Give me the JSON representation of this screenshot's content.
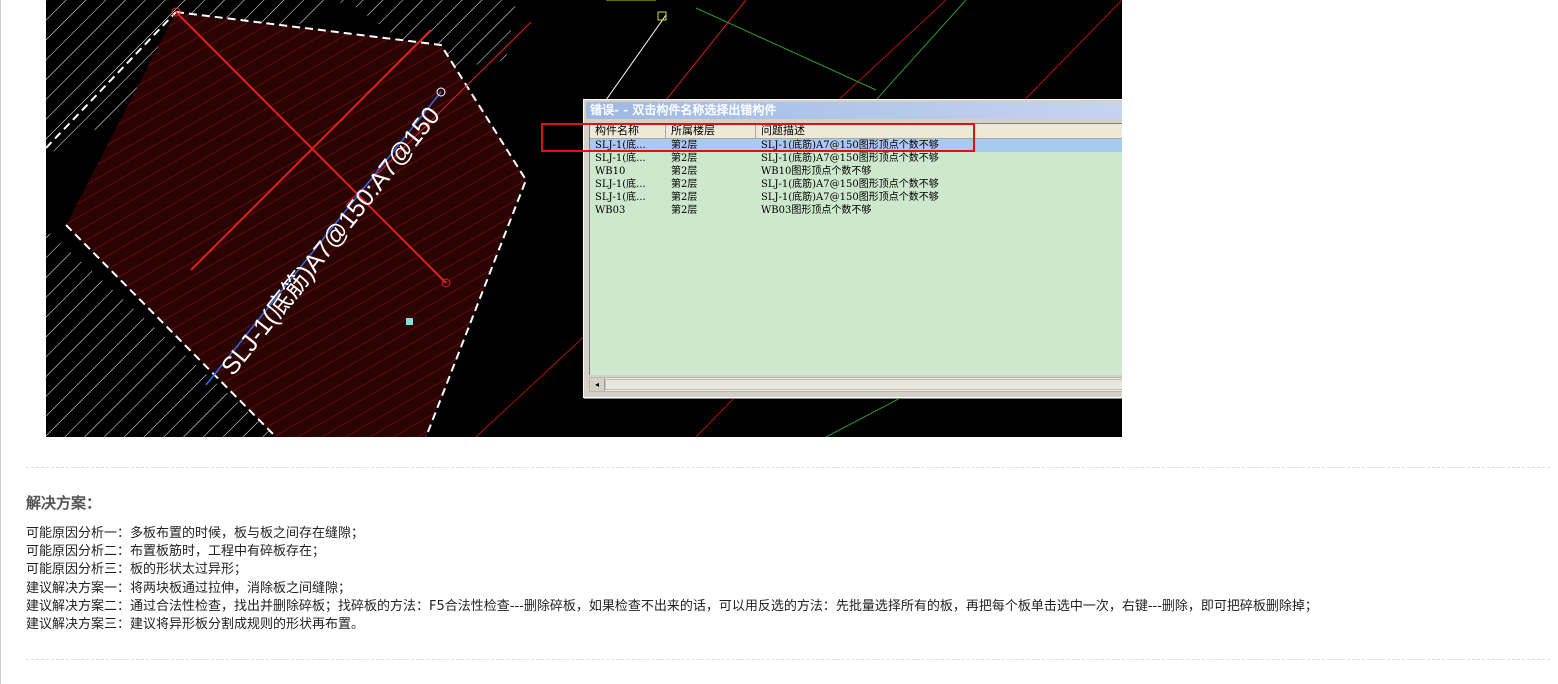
{
  "figure": {
    "dimension_label": "SLJ-1(底筋)A7@150:A7@150",
    "dialog": {
      "title": "错误- - 双击构件名称选择出错构件",
      "columns": [
        "构件名称",
        "所属楼层",
        "问题描述"
      ],
      "rows": [
        {
          "name": "SLJ-1(底...",
          "floor": "第2层",
          "desc": "SLJ-1(底筋)A7@150图形顶点个数不够"
        },
        {
          "name": "SLJ-1(底...",
          "floor": "第2层",
          "desc": "SLJ-1(底筋)A7@150图形顶点个数不够"
        },
        {
          "name": "WB10",
          "floor": "第2层",
          "desc": "WB10图形顶点个数不够"
        },
        {
          "name": "SLJ-1(底...",
          "floor": "第2层",
          "desc": "SLJ-1(底筋)A7@150图形顶点个数不够"
        },
        {
          "name": "SLJ-1(底...",
          "floor": "第2层",
          "desc": "SLJ-1(底筋)A7@150图形顶点个数不够"
        },
        {
          "name": "WB03",
          "floor": "第2层",
          "desc": "WB03图形顶点个数不够"
        }
      ],
      "selected_row": 0,
      "scroll_left_arrow": "◂"
    },
    "colors": {
      "highlight": "#e01010",
      "list_bg": "#cde8cd",
      "selected_bg": "#a7cbf0"
    }
  },
  "solution": {
    "title": "解决方案：",
    "lines": [
      "可能原因分析一：多板布置的时候，板与板之间存在缝隙；",
      "可能原因分析二：布置板筋时，工程中有碎板存在；",
      "可能原因分析三：板的形状太过异形；",
      "建议解决方案一：将两块板通过拉伸，消除板之间缝隙；",
      "建议解决方案二：通过合法性检查，找出并删除碎板；找碎板的方法：F5合法性检查---删除碎板，如果检查不出来的话，可以用反选的方法：先批量选择所有的板，再把每个板单击选中一次，右键---删除，即可把碎板删除掉；",
      "建议解决方案三：建议将异形板分割成规则的形状再布置。"
    ]
  }
}
